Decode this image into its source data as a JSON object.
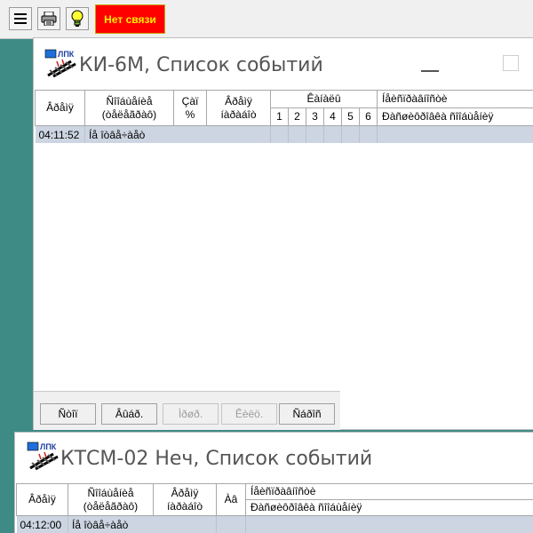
{
  "toolbar": {
    "menu_icon": "hamburger-icon",
    "print_icon": "printer-icon",
    "hint_icon": "lightbulb-icon",
    "status_label": "Нет связи",
    "status_color": "#ff0000"
  },
  "window1": {
    "title": "КИ-6М, Список событий",
    "logo_text": "ЛПК",
    "headers": {
      "time": "Âðåìÿ",
      "message_line1": "Ñîîáùåíèå",
      "message_line2": "(òåëåãðàô)",
      "cap_line1": "Çàï",
      "cap_line2": "%",
      "time2_line1": "Âðåìÿ",
      "time2_line2": "íàðàáîò",
      "channels": "Êàíàëû",
      "channel_numbers": [
        "1",
        "2",
        "3",
        "4",
        "5",
        "6"
      ],
      "note_line1": "Íåèñïðàâíîñòè",
      "note_line2": "Ðàñøèôðîâêà ñîîáùåíèÿ"
    },
    "rows": [
      {
        "time": "04:11:52",
        "message": "Íå îòâå÷àåò"
      }
    ],
    "buttons": {
      "stop": "Ñòîï",
      "select": "Âûáð.",
      "ungroup": "Ìðøð.",
      "clear": "Êèëö.",
      "close": "Ñáðîñ"
    }
  },
  "window2": {
    "title": "КТСМ-02 Неч, Список событий",
    "logo_text": "ЛПК",
    "headers": {
      "time": "Âðåìÿ",
      "message_line1": "Ñîîáùåíèå",
      "message_line2": "(òåëåãðàô)",
      "time2_line1": "Âðåìÿ",
      "time2_line2": "íàðàáîò",
      "axis": "Àâ",
      "note_line1": "Íåèñïðàâíîñòè",
      "note_line2": "Ðàñøèôðîâêà ñîîáùåíèÿ"
    },
    "rows": [
      {
        "time": "04:12:00",
        "message": "Íå îòâå÷àåò"
      }
    ]
  }
}
